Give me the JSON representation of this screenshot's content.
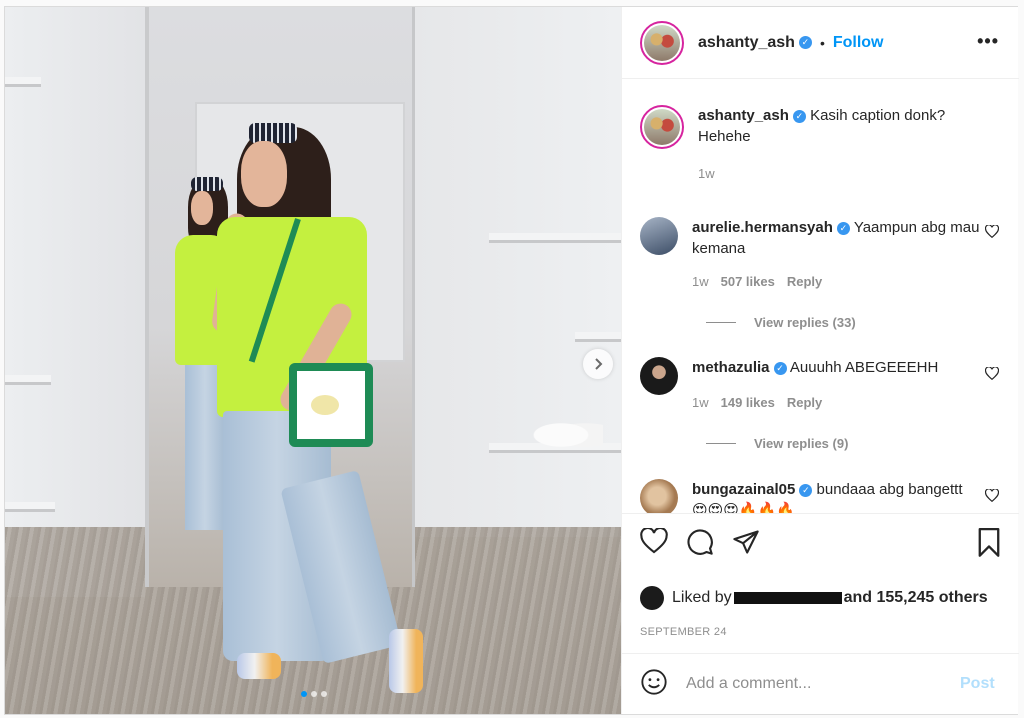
{
  "post": {
    "author": "ashanty_ash",
    "follow_label": "Follow",
    "separator": "•",
    "more_label": "•••",
    "caption": {
      "name": "ashanty_ash",
      "text": "Kasih caption donk? Hehehe",
      "time": "1w"
    },
    "comments": [
      {
        "name": "aurelie.hermansyah",
        "text": "Yaampun abg mau kemana",
        "time": "1w",
        "likes": "507 likes",
        "reply": "Reply",
        "view_replies": "View replies (33)"
      },
      {
        "name": "methazulia",
        "text": "Auuuhh ABEGEEEHH",
        "time": "1w",
        "likes": "149 likes",
        "reply": "Reply",
        "view_replies": "View replies (9)"
      },
      {
        "name": "bungazainal05",
        "text": "bundaaa abg bangettt 😍😍😍🔥🔥🔥",
        "time": "",
        "likes": "",
        "reply": "",
        "view_replies": ""
      }
    ],
    "liked_by_prefix": "Liked by",
    "liked_by_suffix": "and 155,245 others",
    "date": "SEPTEMBER 24",
    "add_comment_placeholder": "Add a comment...",
    "post_label": "Post",
    "carousel": {
      "dots": 3,
      "active": 0
    }
  },
  "icons": {
    "verified": "verified-badge-icon",
    "like": "heart-icon",
    "comment": "comment-bubble-icon",
    "share": "paper-plane-icon",
    "save": "bookmark-icon",
    "emoji": "smiley-icon",
    "next": "chevron-right-icon"
  },
  "colors": {
    "accent": "#0095f6",
    "verified": "#3897f0",
    "muted": "#8e8e8e",
    "post_disabled": "#b2dffc"
  }
}
